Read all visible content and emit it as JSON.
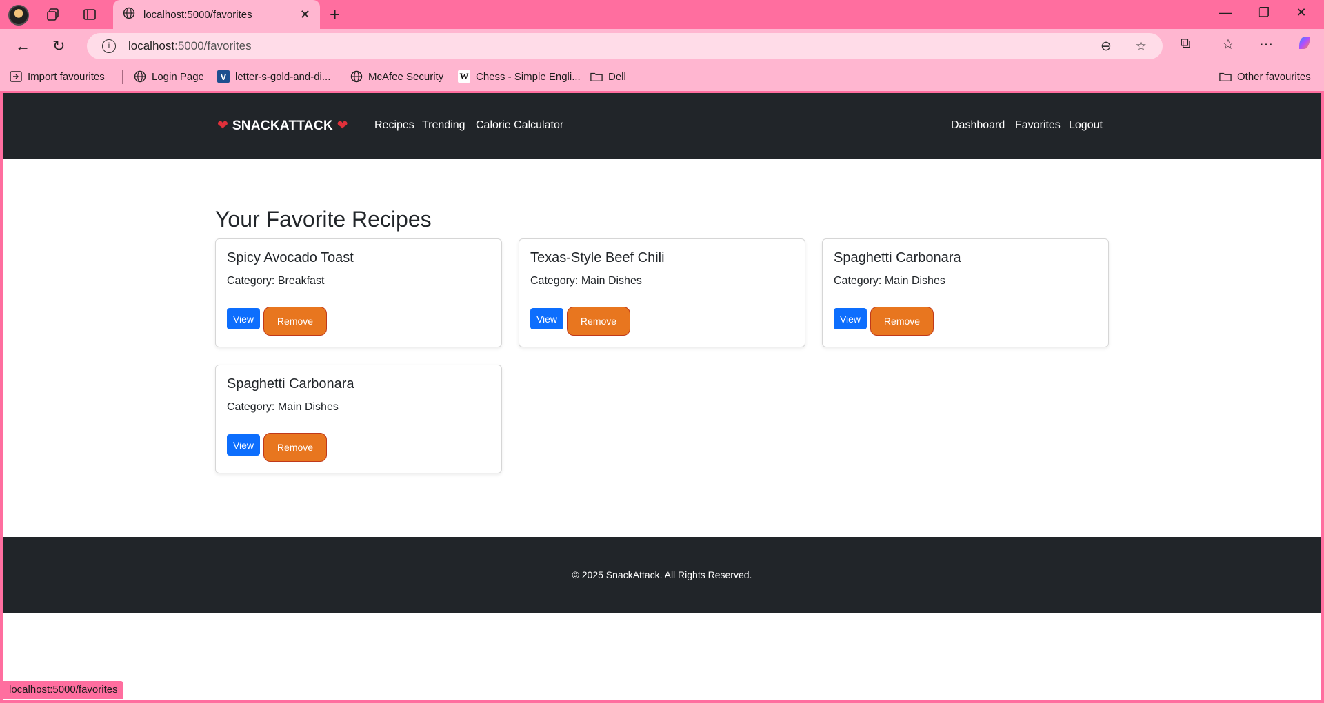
{
  "browser": {
    "tab_title": "localhost:5000/favorites",
    "url_host": "localhost",
    "url_path": ":5000/favorites",
    "bookmarks": [
      {
        "label": "Import favourites",
        "icon": "import-icon"
      },
      {
        "label": "Login Page",
        "icon": "globe-icon"
      },
      {
        "label": "letter-s-gold-and-di...",
        "icon": "v-logo-icon"
      },
      {
        "label": "McAfee Security",
        "icon": "globe-icon"
      },
      {
        "label": "Chess - Simple Engli...",
        "icon": "wikipedia-icon"
      },
      {
        "label": "Dell",
        "icon": "folder-icon"
      }
    ],
    "other_favourites": "Other favourites",
    "status_url": "localhost:5000/favorites"
  },
  "site": {
    "brand": "SNACKATTACK",
    "nav_left": [
      "Recipes",
      "Trending",
      "Calorie Calculator"
    ],
    "nav_right": [
      "Dashboard",
      "Favorites",
      "Logout"
    ],
    "page_title": "Your Favorite Recipes",
    "view_label": "View",
    "remove_label": "Remove",
    "recipes": [
      {
        "title": "Spicy Avocado Toast",
        "category": "Category: Breakfast"
      },
      {
        "title": "Texas-Style Beef Chili",
        "category": "Category: Main Dishes"
      },
      {
        "title": "Spaghetti Carbonara",
        "category": "Category: Main Dishes"
      },
      {
        "title": "Spaghetti Carbonara",
        "category": "Category: Main Dishes"
      }
    ],
    "footer": "© 2025 SnackAttack. All Rights Reserved."
  },
  "colors": {
    "chrome_dark": "#ff6e9f",
    "chrome_light": "#ffb6d0",
    "navbar": "#212529",
    "view_button": "#0d6efd",
    "remove_button": "#e8761f"
  }
}
